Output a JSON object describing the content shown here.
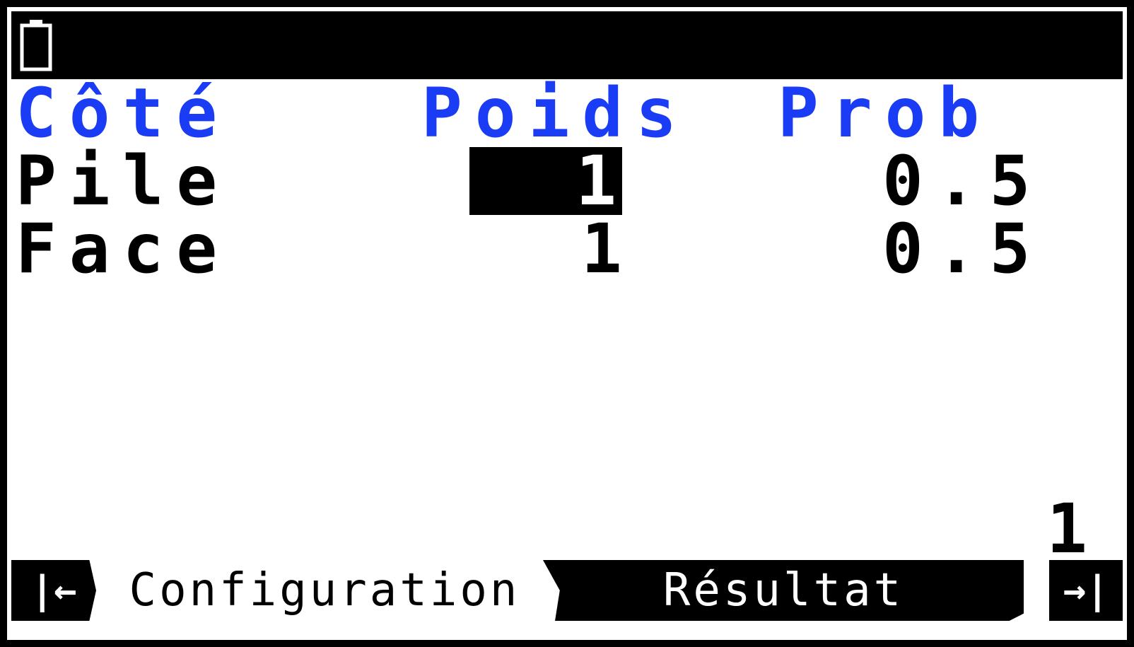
{
  "table": {
    "headers": [
      "Côté",
      "Poids",
      "Prob"
    ],
    "rows": [
      {
        "side": "Pile",
        "weight": "1",
        "prob": "0.5"
      },
      {
        "side": "Face",
        "weight": "1",
        "prob": "0.5"
      }
    ]
  },
  "page_number": "1",
  "bottom_bar": {
    "nav_left": "|←",
    "tab_configuration": "Configuration",
    "tab_result": "Résultat",
    "nav_right": "→|"
  },
  "colors": {
    "header": "#1a3cf5",
    "bar": "#000000",
    "background": "#ffffff"
  },
  "icons": {
    "battery": "battery-icon"
  }
}
